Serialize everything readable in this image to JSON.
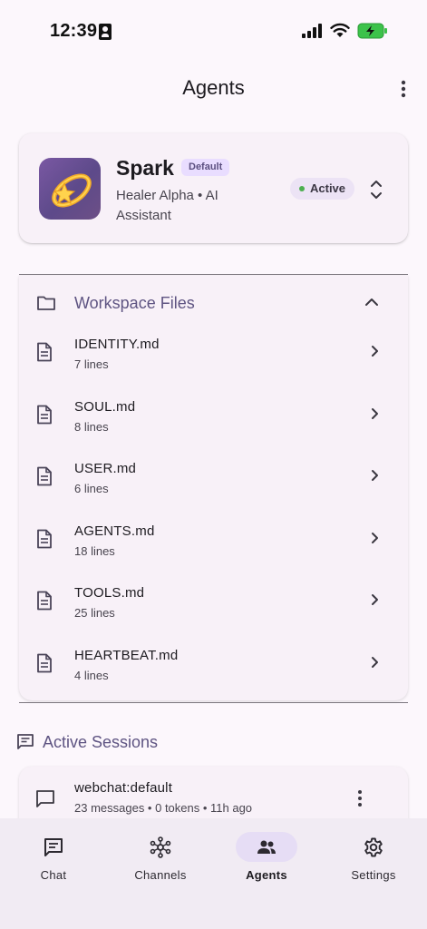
{
  "status_bar": {
    "time": "12:39",
    "icons": [
      "id-card-icon",
      "signal-icon",
      "wifi-icon",
      "battery-charging-icon"
    ]
  },
  "app_bar": {
    "title": "Agents",
    "menu_icon": "more-vert-icon"
  },
  "agent": {
    "name": "Spark",
    "badge": "Default",
    "subtitle": "Healer Alpha • AI Assistant",
    "status": "Active",
    "status_color": "#4caf50",
    "avatar_icon": "dizzy-star-icon"
  },
  "workspace_files": {
    "title": "Workspace Files",
    "files": [
      {
        "name": "IDENTITY.md",
        "lines": "7 lines"
      },
      {
        "name": "SOUL.md",
        "lines": "8 lines"
      },
      {
        "name": "USER.md",
        "lines": "6 lines"
      },
      {
        "name": "AGENTS.md",
        "lines": "18 lines"
      },
      {
        "name": "TOOLS.md",
        "lines": "25 lines"
      },
      {
        "name": "HEARTBEAT.md",
        "lines": "4 lines"
      }
    ]
  },
  "active_sessions": {
    "title": "Active Sessions",
    "sessions": [
      {
        "name": "webchat:default",
        "meta": "23 messages • 0 tokens • 11h ago"
      }
    ]
  },
  "bottom_nav": {
    "items": [
      {
        "label": "Chat",
        "icon": "chat-icon",
        "active": false
      },
      {
        "label": "Channels",
        "icon": "hub-icon",
        "active": false
      },
      {
        "label": "Agents",
        "icon": "group-icon",
        "active": true
      },
      {
        "label": "Settings",
        "icon": "gear-icon",
        "active": false
      }
    ]
  },
  "colors": {
    "accent": "#5e5482",
    "background": "#fcf7fc",
    "surface": "#f8f1f8",
    "active_pill": "#e6ddf5",
    "battery_green": "#3cc24a"
  }
}
